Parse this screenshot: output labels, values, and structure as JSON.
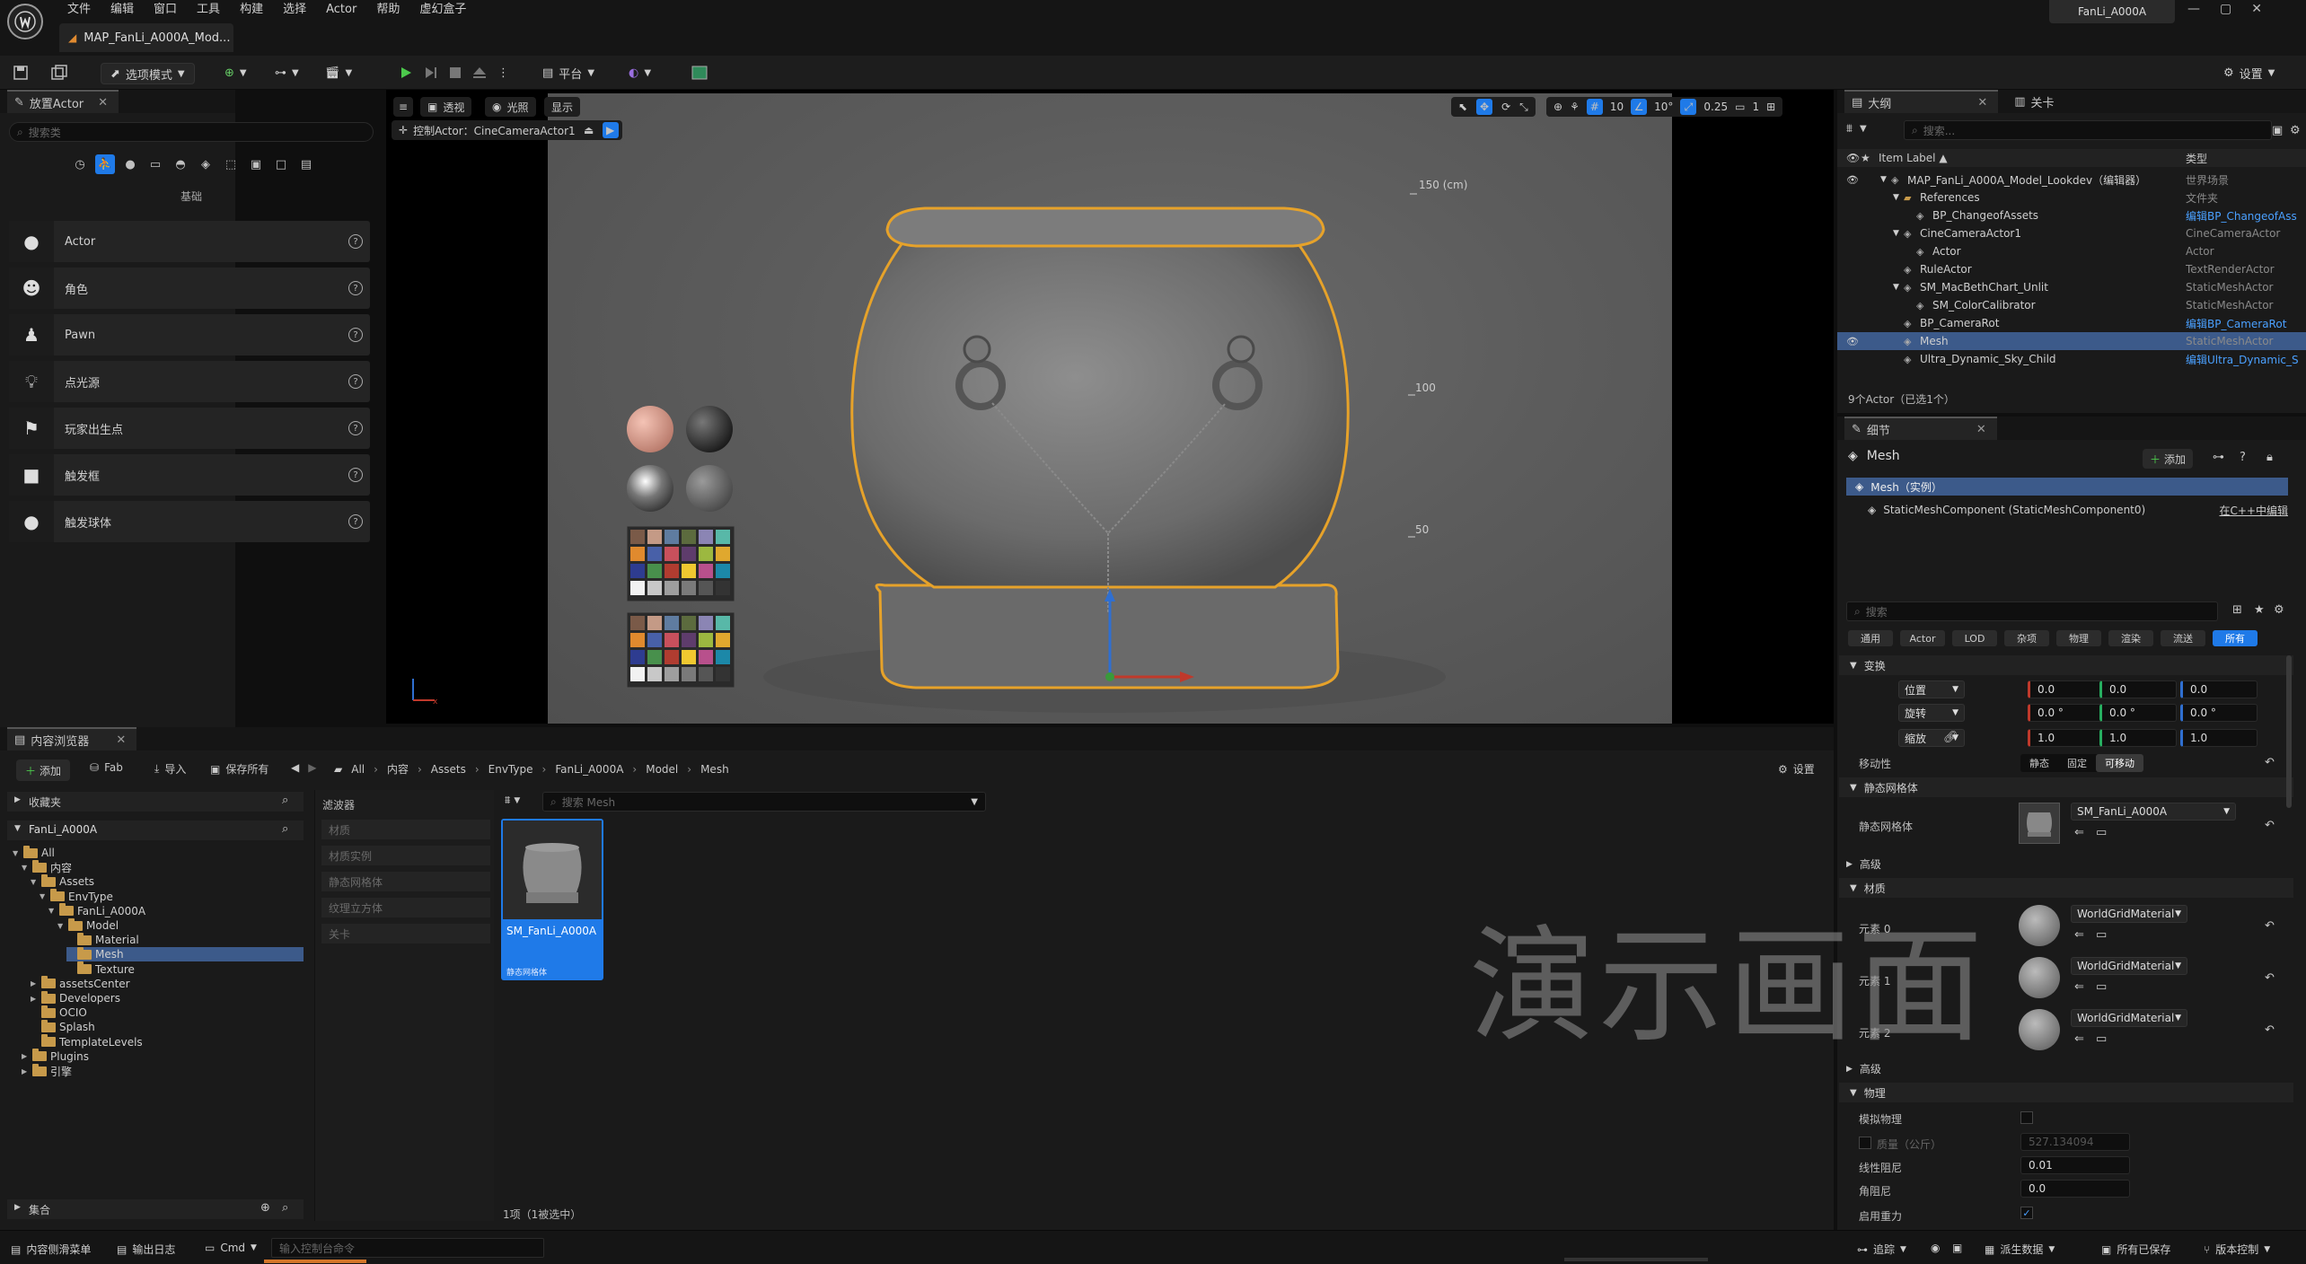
{
  "app": {
    "menus": [
      "文件",
      "编辑",
      "窗口",
      "工具",
      "构建",
      "选择",
      "Actor",
      "帮助",
      "虚幻盒子"
    ],
    "doc_tab": "MAP_FanLi_A000A_Mod...",
    "project_tab": "FanLi_A000A",
    "settings": "设置"
  },
  "toolbar": {
    "mode": "选项模式",
    "platform": "平台"
  },
  "place_actor": {
    "tab": "放置Actor",
    "search_placeholder": "搜索类",
    "category": "基础",
    "items": [
      {
        "label": "Actor",
        "icon": "sphere-icon"
      },
      {
        "label": "角色",
        "icon": "character-icon"
      },
      {
        "label": "Pawn",
        "icon": "pawn-icon"
      },
      {
        "label": "点光源",
        "icon": "light-bulb-icon"
      },
      {
        "label": "玩家出生点",
        "icon": "flag-icon"
      },
      {
        "label": "触发框",
        "icon": "cube-icon"
      },
      {
        "label": "触发球体",
        "icon": "sphere-icon"
      }
    ]
  },
  "viewport": {
    "perspective": "透视",
    "lit": "光照",
    "show": "显示",
    "pilot": "控制Actor：CineCameraActor1",
    "grid_snap": "10",
    "rot_snap": "10°",
    "scale_snap": "0.25",
    "cam_speed": "1",
    "ruler_top": "150 (cm)",
    "ruler_mid": "100",
    "ruler_low": "50"
  },
  "outliner": {
    "tab": "大纲",
    "tab2": "关卡",
    "search_placeholder": "搜索...",
    "col_label": "Item Label ▲",
    "col_type": "类型",
    "rows": [
      {
        "label": "MAP_FanLi_A000A_Model_Lookdev（编辑器）",
        "type": "世界场景",
        "link": false
      },
      {
        "label": "References",
        "type": "文件夹",
        "link": false
      },
      {
        "label": "BP_ChangeofAssets",
        "type": "编辑BP_ChangeofAss",
        "link": true
      },
      {
        "label": "CineCameraActor1",
        "type": "CineCameraActor",
        "link": false
      },
      {
        "label": "Actor",
        "type": "Actor",
        "link": false
      },
      {
        "label": "RuleActor",
        "type": "TextRenderActor",
        "link": false
      },
      {
        "label": "SM_MacBethChart_Unlit",
        "type": "StaticMeshActor",
        "link": false
      },
      {
        "label": "SM_ColorCalibrator",
        "type": "StaticMeshActor",
        "link": false
      },
      {
        "label": "BP_CameraRot",
        "type": "编辑BP_CameraRot",
        "link": true
      },
      {
        "label": "Mesh",
        "type": "StaticMeshActor",
        "link": false
      },
      {
        "label": "Ultra_Dynamic_Sky_Child",
        "type": "编辑Ultra_Dynamic_S",
        "link": true
      }
    ],
    "count": "9个Actor（已选1个）"
  },
  "details": {
    "tab": "细节",
    "title": "Mesh",
    "add": "添加",
    "instance": "Mesh（实例）",
    "component": "StaticMeshComponent (StaticMeshComponent0)",
    "cpp_link": "在C++中编辑",
    "search_placeholder": "搜索",
    "filters": [
      "通用",
      "Actor",
      "LOD",
      "杂项",
      "物理",
      "渲染",
      "流送",
      "所有"
    ],
    "transform_section": "变换",
    "location": "位置",
    "rotation": "旋转",
    "scale": "缩放",
    "loc": [
      "0.0",
      "0.0",
      "0.0"
    ],
    "rot": [
      "0.0 °",
      "0.0 °",
      "0.0 °"
    ],
    "scl": [
      "1.0",
      "1.0",
      "1.0"
    ],
    "mobility": "移动性",
    "mobility_opts": [
      "静态",
      "固定",
      "可移动"
    ],
    "static_mesh_section": "静态网格体",
    "static_mesh_label": "静态网格体",
    "static_mesh_value": "SM_FanLi_A000A",
    "advanced": "高级",
    "materials_section": "材质",
    "elements": [
      "元素 0",
      "元素 1",
      "元素 2"
    ],
    "material_value": "WorldGridMaterial",
    "advanced2": "高级",
    "physics_section": "物理",
    "simulate": "模拟物理",
    "mass": "质量（公斤）",
    "mass_value": "527.134094",
    "linear_damping": "线性阻尼",
    "linear_value": "0.01",
    "angular_damping": "角阻尼",
    "angular_value": "0.0",
    "gravity": "启用重力"
  },
  "content": {
    "tab": "内容浏览器",
    "add": "添加",
    "fab": "Fab",
    "import": "导入",
    "save_all": "保存所有",
    "settings": "设置",
    "breadcrumb": [
      "All",
      "内容",
      "Assets",
      "EnvType",
      "FanLi_A000A",
      "Model",
      "Mesh"
    ],
    "favorites": "收藏夹",
    "project": "FanLi_A000A",
    "tree": [
      {
        "label": "All",
        "level": 0,
        "open": true
      },
      {
        "label": "内容",
        "level": 1,
        "open": true
      },
      {
        "label": "Assets",
        "level": 2,
        "open": true
      },
      {
        "label": "EnvType",
        "level": 3,
        "open": true
      },
      {
        "label": "FanLi_A000A",
        "level": 4,
        "open": true
      },
      {
        "label": "Model",
        "level": 5,
        "open": true
      },
      {
        "label": "Material",
        "level": 6,
        "open": false
      },
      {
        "label": "Mesh",
        "level": 6,
        "open": false
      },
      {
        "label": "Texture",
        "level": 6,
        "open": false
      },
      {
        "label": "assetsCenter",
        "level": 2,
        "open": false
      },
      {
        "label": "Developers",
        "level": 2,
        "open": false
      },
      {
        "label": "OCIO",
        "level": 2,
        "open": false
      },
      {
        "label": "Splash",
        "level": 2,
        "open": false
      },
      {
        "label": "TemplateLevels",
        "level": 2,
        "open": false
      },
      {
        "label": "Plugins",
        "level": 1,
        "open": false
      },
      {
        "label": "引擎",
        "level": 1,
        "open": false
      }
    ],
    "filters_title": "滤波器",
    "filters": [
      "材质",
      "材质实例",
      "静态网格体",
      "纹理立方体",
      "关卡"
    ],
    "asset_search": "搜索 Mesh",
    "asset_name": "SM_FanLi_A000A",
    "asset_type": "静态网格体",
    "collections": "集合",
    "item_count": "1项（1被选中）"
  },
  "statusbar": {
    "drawer": "内容侧滑菜单",
    "output": "输出日志",
    "cmd": "Cmd",
    "console_placeholder": "输入控制台命令",
    "trace": "追踪",
    "derived": "派生数据",
    "saved": "所有已保存",
    "source": "版本控制"
  },
  "watermark": "演示画面"
}
